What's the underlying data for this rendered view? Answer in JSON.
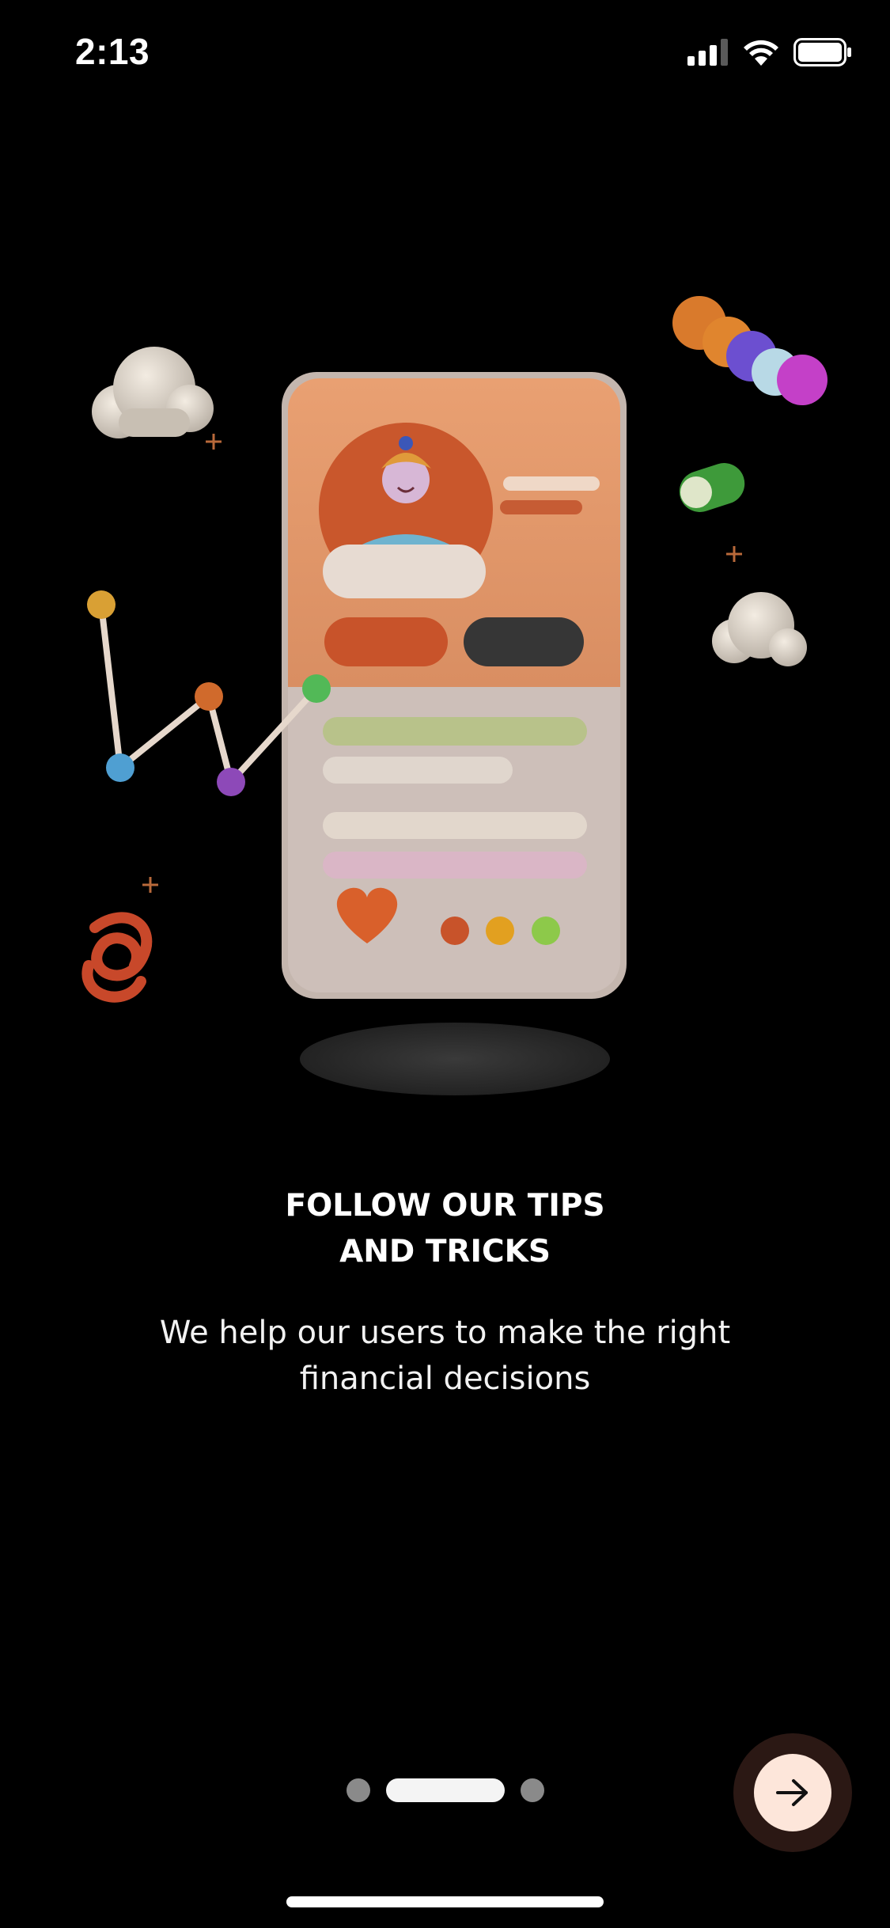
{
  "status_bar": {
    "time": "2:13",
    "icons": [
      "cellular-signal-icon",
      "wifi-icon",
      "battery-icon"
    ]
  },
  "illustration": {
    "name": "phone-finance-illustration"
  },
  "onboarding": {
    "title": "FOLLOW OUR TIPS\nAND TRICKS",
    "subtitle": "We help our users to make the right\nfinancial decisions"
  },
  "pager": {
    "total": 3,
    "current": 2
  },
  "next_button": {
    "icon": "arrow-right-icon"
  },
  "colors": {
    "background": "#000000",
    "accent": "#fde6da",
    "button_ring": "#2b1814"
  }
}
